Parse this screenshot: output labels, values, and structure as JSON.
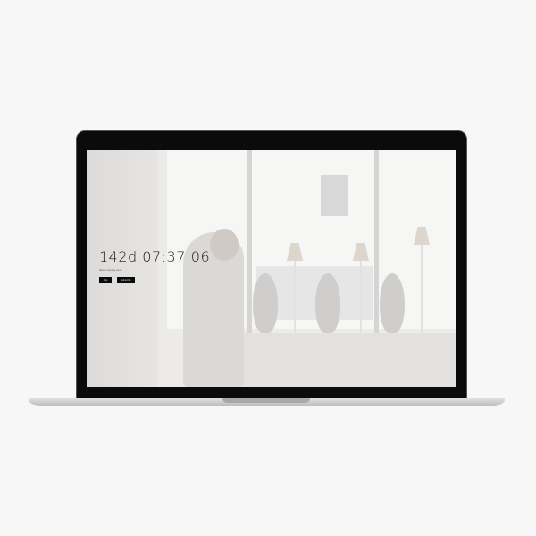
{
  "countdown": {
    "value": "142d 07:37:06",
    "subtitle": "about coming soon"
  },
  "buttons": [
    {
      "label": "Join"
    },
    {
      "label": "Subscribe"
    }
  ],
  "colors": {
    "background": "#f7f7f7",
    "bezel": "#0b0b0b",
    "button": "#0a0a0a"
  }
}
